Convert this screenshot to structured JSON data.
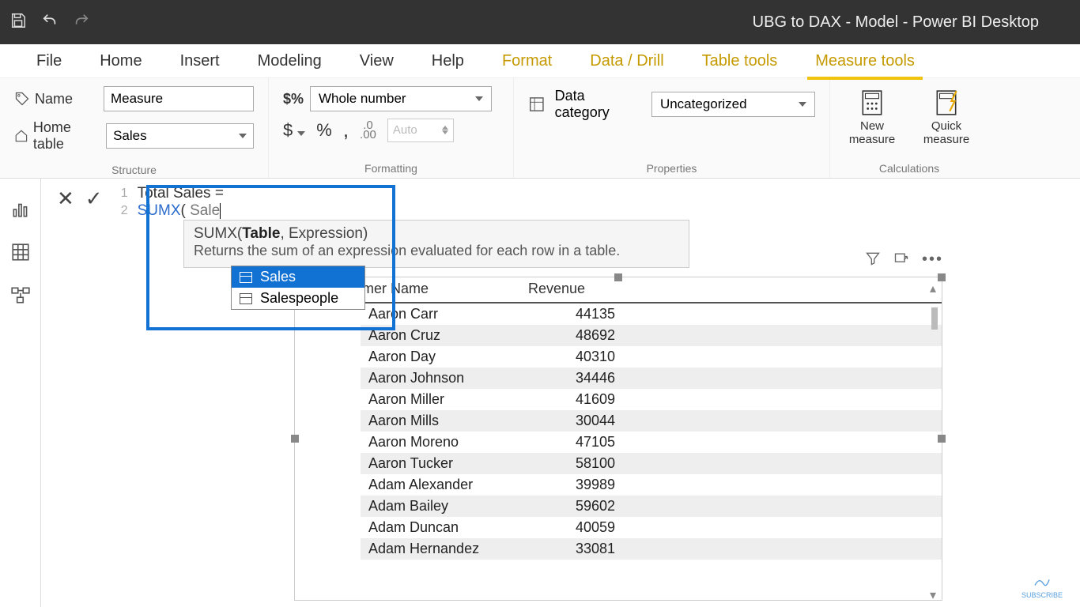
{
  "title": "UBG to DAX - Model - Power BI Desktop",
  "tabs": [
    "File",
    "Home",
    "Insert",
    "Modeling",
    "View",
    "Help",
    "Format",
    "Data / Drill",
    "Table tools",
    "Measure tools"
  ],
  "active_tab": "Measure tools",
  "contextual_start_index": 6,
  "structure": {
    "name_label": "Name",
    "name_value": "Measure",
    "home_table_label": "Home table",
    "home_table_value": "Sales",
    "group": "Structure"
  },
  "formatting": {
    "format_value": "Whole number",
    "currency_symbol": "$",
    "percent": "%",
    "comma": ",",
    "decimal_button": ".00",
    "decimals_value": "Auto",
    "group": "Formatting"
  },
  "properties": {
    "label": "Data category",
    "value": "Uncategorized",
    "group": "Properties"
  },
  "calculations": {
    "new_measure": "New measure",
    "quick_measure": "Quick measure",
    "group": "Calculations"
  },
  "formula": {
    "line1_gutter": "1",
    "line1_text": "Total Sales =",
    "line2_gutter": "2",
    "line2_fn": "SUMX",
    "line2_open": "(",
    "line2_typed": "Sale"
  },
  "tooltip": {
    "sig_fn": "SUMX",
    "sig_rest_pre": "(",
    "sig_bold": "Table",
    "sig_rest_post": ", Expression)",
    "desc": "Returns the sum of an expression evaluated for each row in a table."
  },
  "intellisense": [
    "Sales",
    "Salespeople"
  ],
  "visual": {
    "filter_icon": "filter",
    "focus_icon": "focus",
    "more_icon": "more",
    "col1": "Customer Name",
    "col2": "Revenue",
    "rows": [
      {
        "name": "Aaron Carr",
        "rev": 44135
      },
      {
        "name": "Aaron Cruz",
        "rev": 48692
      },
      {
        "name": "Aaron Day",
        "rev": 40310
      },
      {
        "name": "Aaron Johnson",
        "rev": 34446
      },
      {
        "name": "Aaron Miller",
        "rev": 41609
      },
      {
        "name": "Aaron Mills",
        "rev": 30044
      },
      {
        "name": "Aaron Moreno",
        "rev": 47105
      },
      {
        "name": "Aaron Tucker",
        "rev": 58100
      },
      {
        "name": "Adam Alexander",
        "rev": 39989
      },
      {
        "name": "Adam Bailey",
        "rev": 59602
      },
      {
        "name": "Adam Duncan",
        "rev": 40059
      },
      {
        "name": "Adam Hernandez",
        "rev": 33081
      }
    ]
  },
  "subscribe": "SUBSCRIBE"
}
